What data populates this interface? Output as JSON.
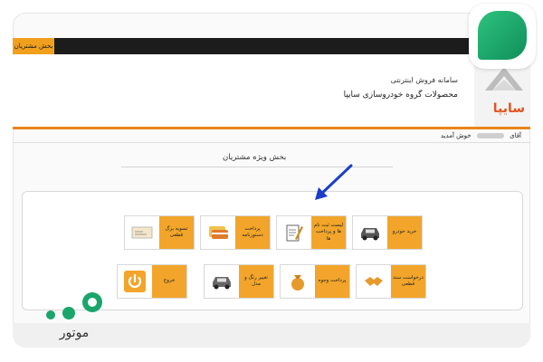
{
  "topbar": {
    "customer_tab": "بخش مشتریان"
  },
  "header": {
    "line1": "سامانه فروش اینترنتی",
    "line2": "محصولات گروه خودروسازی سایپا",
    "logo_text": "سایپا"
  },
  "welcome": {
    "greeting": "خوش آمدید",
    "prefix": "آقای"
  },
  "section_title": "بخش ویژه مشتریان",
  "tiles_row1": [
    {
      "label": "خرید خودرو",
      "icon": "car-icon"
    },
    {
      "label": "لیست ثبت نام ها و پرداخت ها",
      "icon": "document-pen-icon"
    },
    {
      "label": "پرداخت دستورنامه",
      "icon": "card-payment-icon"
    },
    {
      "label": "تسویه برگ قطعی",
      "icon": "check-slip-icon"
    }
  ],
  "tiles_row2": [
    {
      "label": "درخواست سند قطعی",
      "icon": "handshake-icon"
    },
    {
      "label": "پرداخت وجوه",
      "icon": "money-bag-icon"
    },
    {
      "label": "تغییر رنگ و مدل",
      "icon": "car-icon"
    },
    {
      "label": "خروج",
      "icon": "power-icon"
    }
  ],
  "brand": {
    "watermark_text": "موتور"
  },
  "colors": {
    "accent": "#f2a52a",
    "topbar": "#1c1c1c",
    "logo_orange": "#e0541f",
    "brand_green": "#1aa56b"
  }
}
